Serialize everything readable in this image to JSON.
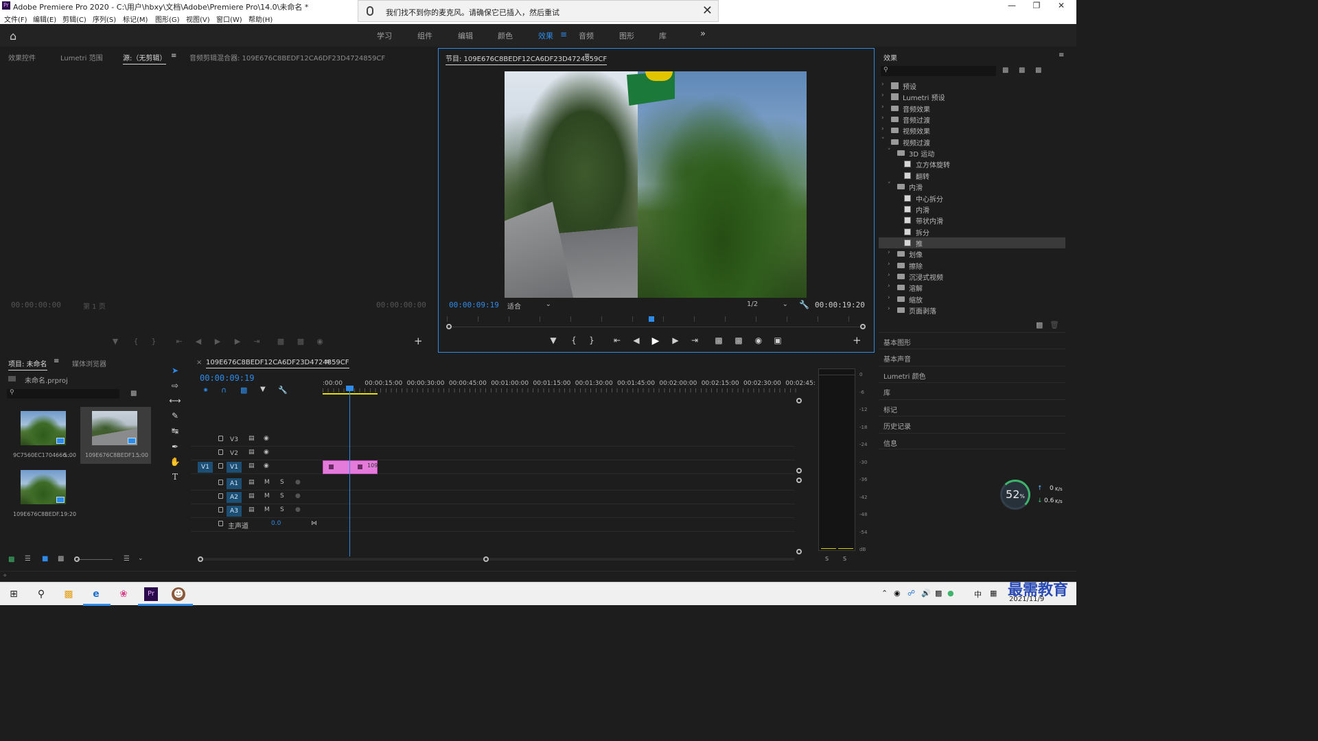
{
  "window": {
    "title": "Adobe Premiere Pro 2020 - C:\\用户\\hbxy\\文档\\Adobe\\Premiere Pro\\14.0\\未命名 *"
  },
  "menu": [
    "文件(F)",
    "编辑(E)",
    "剪辑(C)",
    "序列(S)",
    "标记(M)",
    "图形(G)",
    "视图(V)",
    "窗口(W)",
    "帮助(H)"
  ],
  "notification": {
    "message": "我们找不到你的麦克风。请确保它已插入，然后重试"
  },
  "workspaces": {
    "tabs": [
      "学习",
      "组件",
      "编辑",
      "颜色",
      "效果",
      "音频",
      "图形",
      "库"
    ],
    "active": "效果"
  },
  "source_panel": {
    "tabs": [
      "效果控件",
      "Lumetri 范围",
      "源:（无剪辑）",
      "音频剪辑混合器: 109E676C8BEDF12CA6DF23D4724859CF"
    ],
    "time_left": "00:00:00:00",
    "time_right": "00:00:00:00",
    "page": "第 1 页"
  },
  "program_panel": {
    "title": "节目: 109E676C8BEDF12CA6DF23D4724859CF",
    "current_time": "00:00:09:19",
    "duration": "00:00:19:20",
    "fit": "适合",
    "resolution": "1/2"
  },
  "effects_panel": {
    "title": "效果",
    "items": [
      {
        "label": "预设",
        "level": 0,
        "kind": "preset"
      },
      {
        "label": "Lumetri 预设",
        "level": 0,
        "kind": "preset"
      },
      {
        "label": "音频效果",
        "level": 0,
        "kind": "folder"
      },
      {
        "label": "音频过渡",
        "level": 0,
        "kind": "folder"
      },
      {
        "label": "视频效果",
        "level": 0,
        "kind": "folder"
      },
      {
        "label": "视频过渡",
        "level": 0,
        "kind": "folder",
        "open": true
      },
      {
        "label": "3D 运动",
        "level": 1,
        "kind": "folder",
        "open": true
      },
      {
        "label": "立方体旋转",
        "level": 2,
        "kind": "transition"
      },
      {
        "label": "翻转",
        "level": 2,
        "kind": "transition"
      },
      {
        "label": "内滑",
        "level": 1,
        "kind": "folder",
        "open": true
      },
      {
        "label": "中心拆分",
        "level": 2,
        "kind": "transition"
      },
      {
        "label": "内滑",
        "level": 2,
        "kind": "transition"
      },
      {
        "label": "带状内滑",
        "level": 2,
        "kind": "transition"
      },
      {
        "label": "拆分",
        "level": 2,
        "kind": "transition"
      },
      {
        "label": "推",
        "level": 2,
        "kind": "transition",
        "selected": true
      },
      {
        "label": "划像",
        "level": 1,
        "kind": "folder"
      },
      {
        "label": "擦除",
        "level": 1,
        "kind": "folder"
      },
      {
        "label": "沉浸式视频",
        "level": 1,
        "kind": "folder"
      },
      {
        "label": "溶解",
        "level": 1,
        "kind": "folder"
      },
      {
        "label": "缩放",
        "level": 1,
        "kind": "folder"
      },
      {
        "label": "页面剥落",
        "level": 1,
        "kind": "folder"
      }
    ]
  },
  "side_panels": [
    "基本图形",
    "基本声音",
    "Lumetri 颜色",
    "库",
    "标记",
    "历史记录",
    "信息"
  ],
  "project_panel": {
    "tabs": [
      "项目: 未命名",
      "媒体浏览器"
    ],
    "project_file": "未命名.prproj",
    "clips": [
      {
        "name": "9C7560EC1704666...",
        "duration": "5:00"
      },
      {
        "name": "109E676C8BEDF1...",
        "duration": "5:00"
      },
      {
        "name": "109E676C8BEDF...",
        "duration": "19:20"
      }
    ]
  },
  "timeline": {
    "sequence_name": "109E676C8BEDF12CA6DF23D4724859CF",
    "current_time": "00:00:09:19",
    "ruler": [
      ":00:00",
      "00:00:15:00",
      "00:00:30:00",
      "00:00:45:00",
      "00:01:00:00",
      "00:01:15:00",
      "00:01:30:00",
      "00:01:45:00",
      "00:02:00:00",
      "00:02:15:00",
      "00:02:30:00",
      "00:02:45:"
    ],
    "video_tracks": [
      "V3",
      "V2",
      "V1"
    ],
    "source_patch": "V1",
    "audio_tracks": [
      "A1",
      "A2",
      "A3"
    ],
    "master": {
      "label": "主声道",
      "value": "0.0"
    },
    "clip_label": "109"
  },
  "meter": {
    "scale": [
      "0",
      "-6",
      "-12",
      "-18",
      "-24",
      "-30",
      "-36",
      "-42",
      "-48",
      "-54",
      "dB"
    ]
  },
  "network": {
    "percent": "52",
    "unit": "%",
    "up": "0",
    "down": "0.6",
    "rate_unit": "K/s"
  },
  "taskbar": {
    "ime": "中",
    "date": "2021/11/9"
  },
  "watermark": "最需教育"
}
